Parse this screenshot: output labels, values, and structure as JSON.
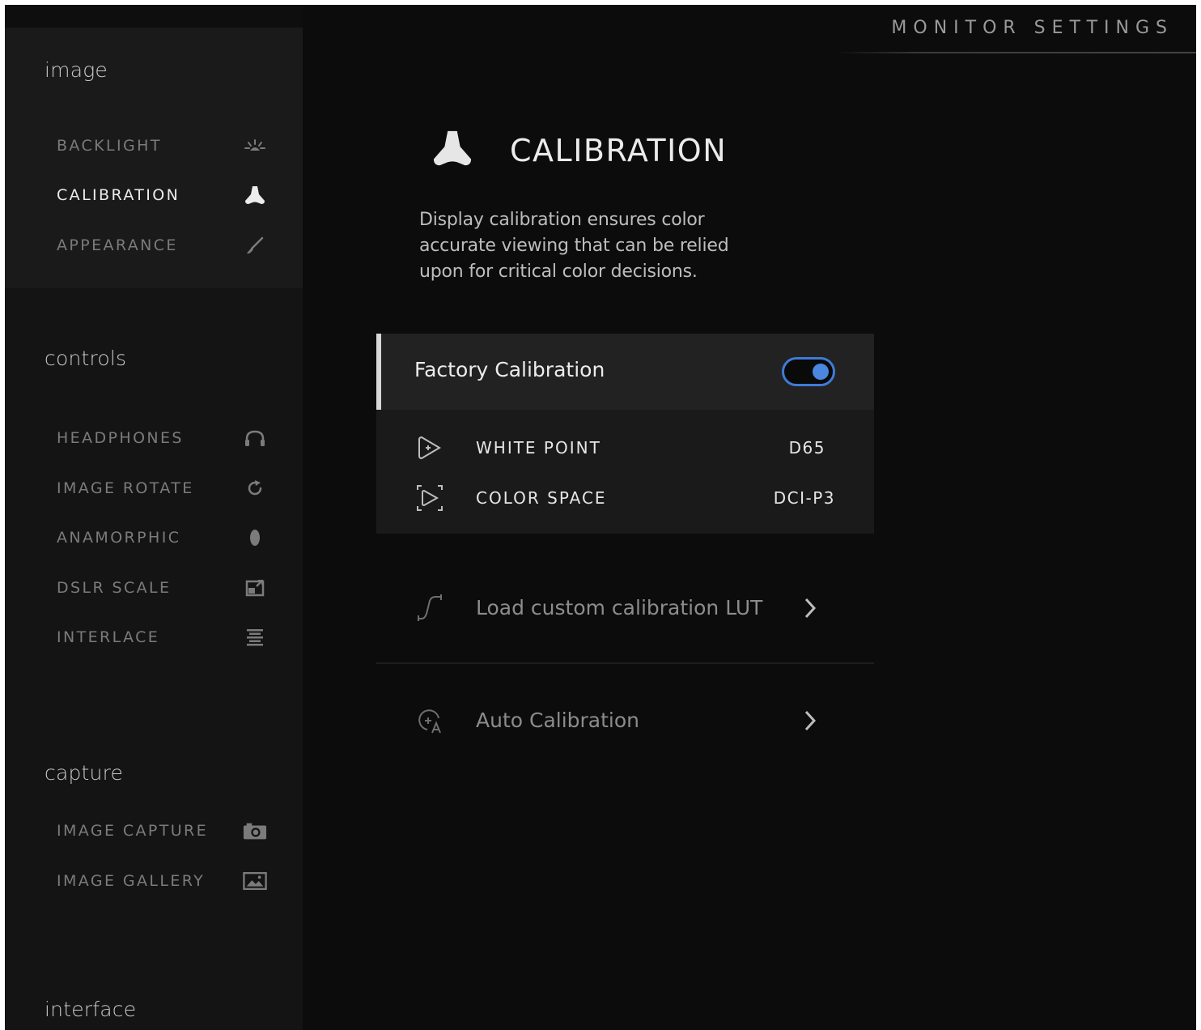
{
  "header": {
    "title": "MONITOR SETTINGS"
  },
  "sidebar": {
    "groups": [
      {
        "title": "image",
        "items": [
          {
            "label": "BACKLIGHT",
            "icon": "backlight-icon"
          },
          {
            "label": "CALIBRATION",
            "icon": "calibration-icon",
            "active": true
          },
          {
            "label": "APPEARANCE",
            "icon": "brush-icon"
          }
        ]
      },
      {
        "title": "controls",
        "items": [
          {
            "label": "HEADPHONES",
            "icon": "headphones-icon"
          },
          {
            "label": "IMAGE ROTATE",
            "icon": "rotate-icon"
          },
          {
            "label": "ANAMORPHIC",
            "icon": "anamorphic-icon"
          },
          {
            "label": "DSLR SCALE",
            "icon": "dslr-scale-icon"
          },
          {
            "label": "INTERLACE",
            "icon": "interlace-icon"
          }
        ]
      },
      {
        "title": "capture",
        "items": [
          {
            "label": "IMAGE CAPTURE",
            "icon": "camera-icon"
          },
          {
            "label": "IMAGE GALLERY",
            "icon": "gallery-icon"
          }
        ]
      },
      {
        "title": "interface",
        "items": []
      }
    ]
  },
  "main": {
    "title": "CALIBRATION",
    "icon": "calibration-icon",
    "description": "Display calibration ensures color accurate viewing that can be relied upon for critical color decisions.",
    "factory_calibration": {
      "label": "Factory Calibration",
      "enabled": true,
      "rows": [
        {
          "label": "WHITE POINT",
          "value": "D65",
          "icon": "white-point-icon"
        },
        {
          "label": "COLOR SPACE",
          "value": "DCI-P3",
          "icon": "color-space-icon"
        }
      ]
    },
    "links": [
      {
        "label": "Load custom calibration LUT",
        "icon": "lut-curve-icon"
      },
      {
        "label": "Auto Calibration",
        "icon": "auto-calibration-icon"
      }
    ]
  },
  "colors": {
    "accent": "#4b86e0",
    "background": "#0c0c0c",
    "sidebar": "#141414",
    "card": "#222222"
  }
}
